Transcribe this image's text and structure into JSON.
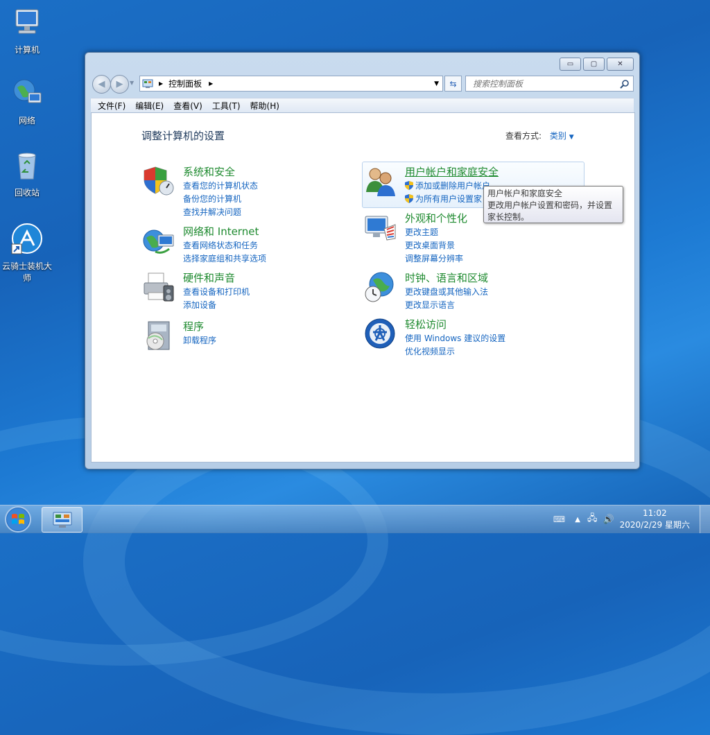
{
  "desktop": {
    "icons": [
      {
        "label": "计算机"
      },
      {
        "label": "网络"
      },
      {
        "label": "回收站"
      },
      {
        "label": "云骑士装机大师"
      }
    ]
  },
  "window": {
    "caption": {
      "minimize": "▭",
      "maximize": "▢",
      "close": "✕"
    },
    "address": {
      "crumb": "控制面板"
    },
    "search": {
      "placeholder": "搜索控制面板"
    },
    "menu": [
      "文件(F)",
      "编辑(E)",
      "查看(V)",
      "工具(T)",
      "帮助(H)"
    ],
    "content": {
      "title": "调整计算机的设置",
      "view_by_label": "查看方式:",
      "view_by_value": "类别",
      "categories": [
        {
          "title": "系统和安全",
          "icon": "shield-icon",
          "links": [
            "查看您的计算机状态",
            "备份您的计算机",
            "查找并解决问题"
          ]
        },
        {
          "title": "网络和 Internet",
          "icon": "network-globe-icon",
          "links": [
            "查看网络状态和任务",
            "选择家庭组和共享选项"
          ]
        },
        {
          "title": "硬件和声音",
          "icon": "printer-icon",
          "links": [
            "查看设备和打印机",
            "添加设备"
          ]
        },
        {
          "title": "程序",
          "icon": "programs-icon",
          "links": [
            "卸载程序"
          ]
        },
        {
          "title": "用户帐户和家庭安全",
          "icon": "users-icon",
          "links": [
            "添加或删除用户帐户",
            "为所有用户设置家"
          ]
        },
        {
          "title": "外观和个性化",
          "icon": "monitor-palette-icon",
          "links": [
            "更改主题",
            "更改桌面背景",
            "调整屏幕分辨率"
          ]
        },
        {
          "title": "时钟、语言和区域",
          "icon": "globe-clock-icon",
          "links": [
            "更改键盘或其他输入法",
            "更改显示语言"
          ]
        },
        {
          "title": "轻松访问",
          "icon": "ease-of-access-icon",
          "links": [
            "使用 Windows 建议的设置",
            "优化视频显示"
          ]
        }
      ]
    },
    "tooltip": {
      "title": "用户帐户和家庭安全",
      "body": "更改用户帐户设置和密码，并设置家长控制。"
    }
  },
  "taskbar": {
    "time": "11:02",
    "date": "2020/2/29 星期六"
  },
  "colors": {
    "link": "#1565c0",
    "category_title": "#1e8a2f",
    "taskbar": "#5a87b9"
  }
}
